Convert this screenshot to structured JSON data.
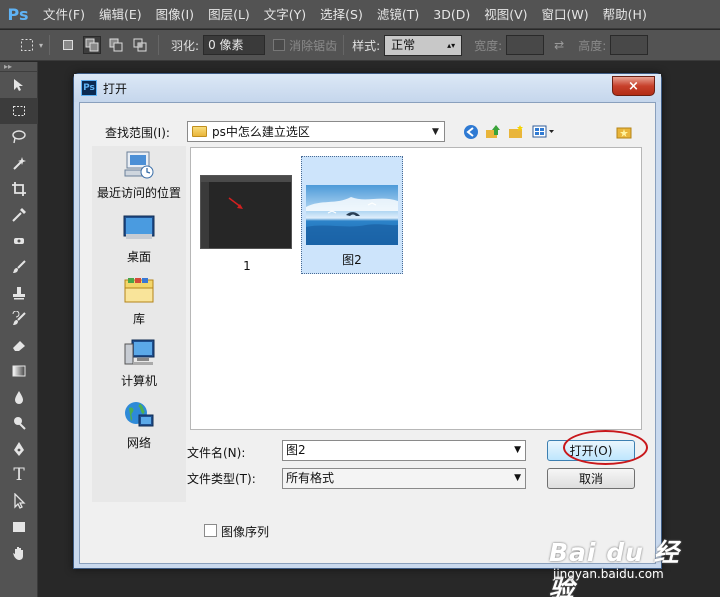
{
  "app": {
    "logo": "Ps",
    "menu": [
      "文件(F)",
      "编辑(E)",
      "图像(I)",
      "图层(L)",
      "文字(Y)",
      "选择(S)",
      "滤镜(T)",
      "3D(D)",
      "视图(V)",
      "窗口(W)",
      "帮助(H)"
    ]
  },
  "options": {
    "feather_label": "羽化:",
    "feather_value": "0 像素",
    "antialias_label": "消除锯齿",
    "style_label": "样式:",
    "style_value": "正常",
    "width_label": "宽度:",
    "height_label": "高度:"
  },
  "dialog": {
    "icon": "Ps",
    "title": "打开",
    "close": "×",
    "lookin_label": "查找范围(I):",
    "lookin_value": "ps中怎么建立选区",
    "places": [
      "最近访问的位置",
      "桌面",
      "库",
      "计算机",
      "网络"
    ],
    "files": [
      {
        "name": "1"
      },
      {
        "name": "图2"
      }
    ],
    "filename_label": "文件名(N):",
    "filename_value": "图2",
    "filetype_label": "文件类型(T):",
    "filetype_value": "所有格式",
    "open_button": "打开(O)",
    "cancel_button": "取消",
    "sequence_label": "图像序列"
  },
  "watermark": {
    "brand": "Bai du 经验",
    "url": "jingyan.baidu.com"
  },
  "colors": {
    "ps_dark": "#535353",
    "canvas": "#282828",
    "dialog_frame": "#c9d9ee",
    "annotation_red": "#c8171b"
  }
}
